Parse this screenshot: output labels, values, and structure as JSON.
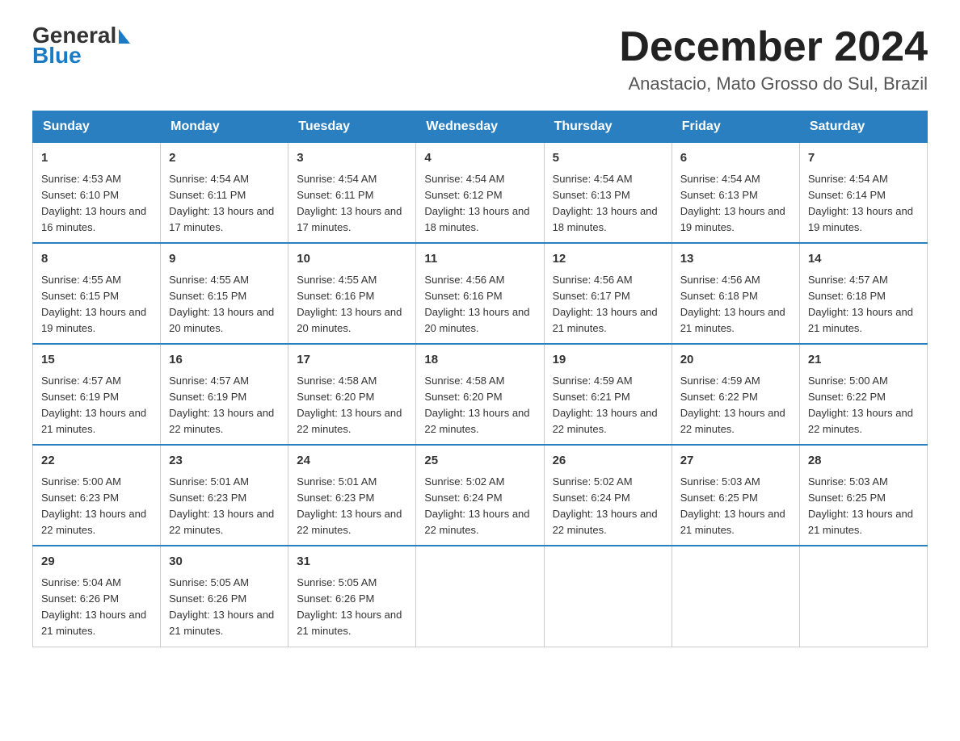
{
  "header": {
    "month_title": "December 2024",
    "location": "Anastacio, Mato Grosso do Sul, Brazil",
    "logo_general": "General",
    "logo_blue": "Blue"
  },
  "weekdays": [
    "Sunday",
    "Monday",
    "Tuesday",
    "Wednesday",
    "Thursday",
    "Friday",
    "Saturday"
  ],
  "weeks": [
    [
      {
        "day": "1",
        "sunrise": "Sunrise: 4:53 AM",
        "sunset": "Sunset: 6:10 PM",
        "daylight": "Daylight: 13 hours and 16 minutes."
      },
      {
        "day": "2",
        "sunrise": "Sunrise: 4:54 AM",
        "sunset": "Sunset: 6:11 PM",
        "daylight": "Daylight: 13 hours and 17 minutes."
      },
      {
        "day": "3",
        "sunrise": "Sunrise: 4:54 AM",
        "sunset": "Sunset: 6:11 PM",
        "daylight": "Daylight: 13 hours and 17 minutes."
      },
      {
        "day": "4",
        "sunrise": "Sunrise: 4:54 AM",
        "sunset": "Sunset: 6:12 PM",
        "daylight": "Daylight: 13 hours and 18 minutes."
      },
      {
        "day": "5",
        "sunrise": "Sunrise: 4:54 AM",
        "sunset": "Sunset: 6:13 PM",
        "daylight": "Daylight: 13 hours and 18 minutes."
      },
      {
        "day": "6",
        "sunrise": "Sunrise: 4:54 AM",
        "sunset": "Sunset: 6:13 PM",
        "daylight": "Daylight: 13 hours and 19 minutes."
      },
      {
        "day": "7",
        "sunrise": "Sunrise: 4:54 AM",
        "sunset": "Sunset: 6:14 PM",
        "daylight": "Daylight: 13 hours and 19 minutes."
      }
    ],
    [
      {
        "day": "8",
        "sunrise": "Sunrise: 4:55 AM",
        "sunset": "Sunset: 6:15 PM",
        "daylight": "Daylight: 13 hours and 19 minutes."
      },
      {
        "day": "9",
        "sunrise": "Sunrise: 4:55 AM",
        "sunset": "Sunset: 6:15 PM",
        "daylight": "Daylight: 13 hours and 20 minutes."
      },
      {
        "day": "10",
        "sunrise": "Sunrise: 4:55 AM",
        "sunset": "Sunset: 6:16 PM",
        "daylight": "Daylight: 13 hours and 20 minutes."
      },
      {
        "day": "11",
        "sunrise": "Sunrise: 4:56 AM",
        "sunset": "Sunset: 6:16 PM",
        "daylight": "Daylight: 13 hours and 20 minutes."
      },
      {
        "day": "12",
        "sunrise": "Sunrise: 4:56 AM",
        "sunset": "Sunset: 6:17 PM",
        "daylight": "Daylight: 13 hours and 21 minutes."
      },
      {
        "day": "13",
        "sunrise": "Sunrise: 4:56 AM",
        "sunset": "Sunset: 6:18 PM",
        "daylight": "Daylight: 13 hours and 21 minutes."
      },
      {
        "day": "14",
        "sunrise": "Sunrise: 4:57 AM",
        "sunset": "Sunset: 6:18 PM",
        "daylight": "Daylight: 13 hours and 21 minutes."
      }
    ],
    [
      {
        "day": "15",
        "sunrise": "Sunrise: 4:57 AM",
        "sunset": "Sunset: 6:19 PM",
        "daylight": "Daylight: 13 hours and 21 minutes."
      },
      {
        "day": "16",
        "sunrise": "Sunrise: 4:57 AM",
        "sunset": "Sunset: 6:19 PM",
        "daylight": "Daylight: 13 hours and 22 minutes."
      },
      {
        "day": "17",
        "sunrise": "Sunrise: 4:58 AM",
        "sunset": "Sunset: 6:20 PM",
        "daylight": "Daylight: 13 hours and 22 minutes."
      },
      {
        "day": "18",
        "sunrise": "Sunrise: 4:58 AM",
        "sunset": "Sunset: 6:20 PM",
        "daylight": "Daylight: 13 hours and 22 minutes."
      },
      {
        "day": "19",
        "sunrise": "Sunrise: 4:59 AM",
        "sunset": "Sunset: 6:21 PM",
        "daylight": "Daylight: 13 hours and 22 minutes."
      },
      {
        "day": "20",
        "sunrise": "Sunrise: 4:59 AM",
        "sunset": "Sunset: 6:22 PM",
        "daylight": "Daylight: 13 hours and 22 minutes."
      },
      {
        "day": "21",
        "sunrise": "Sunrise: 5:00 AM",
        "sunset": "Sunset: 6:22 PM",
        "daylight": "Daylight: 13 hours and 22 minutes."
      }
    ],
    [
      {
        "day": "22",
        "sunrise": "Sunrise: 5:00 AM",
        "sunset": "Sunset: 6:23 PM",
        "daylight": "Daylight: 13 hours and 22 minutes."
      },
      {
        "day": "23",
        "sunrise": "Sunrise: 5:01 AM",
        "sunset": "Sunset: 6:23 PM",
        "daylight": "Daylight: 13 hours and 22 minutes."
      },
      {
        "day": "24",
        "sunrise": "Sunrise: 5:01 AM",
        "sunset": "Sunset: 6:23 PM",
        "daylight": "Daylight: 13 hours and 22 minutes."
      },
      {
        "day": "25",
        "sunrise": "Sunrise: 5:02 AM",
        "sunset": "Sunset: 6:24 PM",
        "daylight": "Daylight: 13 hours and 22 minutes."
      },
      {
        "day": "26",
        "sunrise": "Sunrise: 5:02 AM",
        "sunset": "Sunset: 6:24 PM",
        "daylight": "Daylight: 13 hours and 22 minutes."
      },
      {
        "day": "27",
        "sunrise": "Sunrise: 5:03 AM",
        "sunset": "Sunset: 6:25 PM",
        "daylight": "Daylight: 13 hours and 21 minutes."
      },
      {
        "day": "28",
        "sunrise": "Sunrise: 5:03 AM",
        "sunset": "Sunset: 6:25 PM",
        "daylight": "Daylight: 13 hours and 21 minutes."
      }
    ],
    [
      {
        "day": "29",
        "sunrise": "Sunrise: 5:04 AM",
        "sunset": "Sunset: 6:26 PM",
        "daylight": "Daylight: 13 hours and 21 minutes."
      },
      {
        "day": "30",
        "sunrise": "Sunrise: 5:05 AM",
        "sunset": "Sunset: 6:26 PM",
        "daylight": "Daylight: 13 hours and 21 minutes."
      },
      {
        "day": "31",
        "sunrise": "Sunrise: 5:05 AM",
        "sunset": "Sunset: 6:26 PM",
        "daylight": "Daylight: 13 hours and 21 minutes."
      },
      null,
      null,
      null,
      null
    ]
  ]
}
